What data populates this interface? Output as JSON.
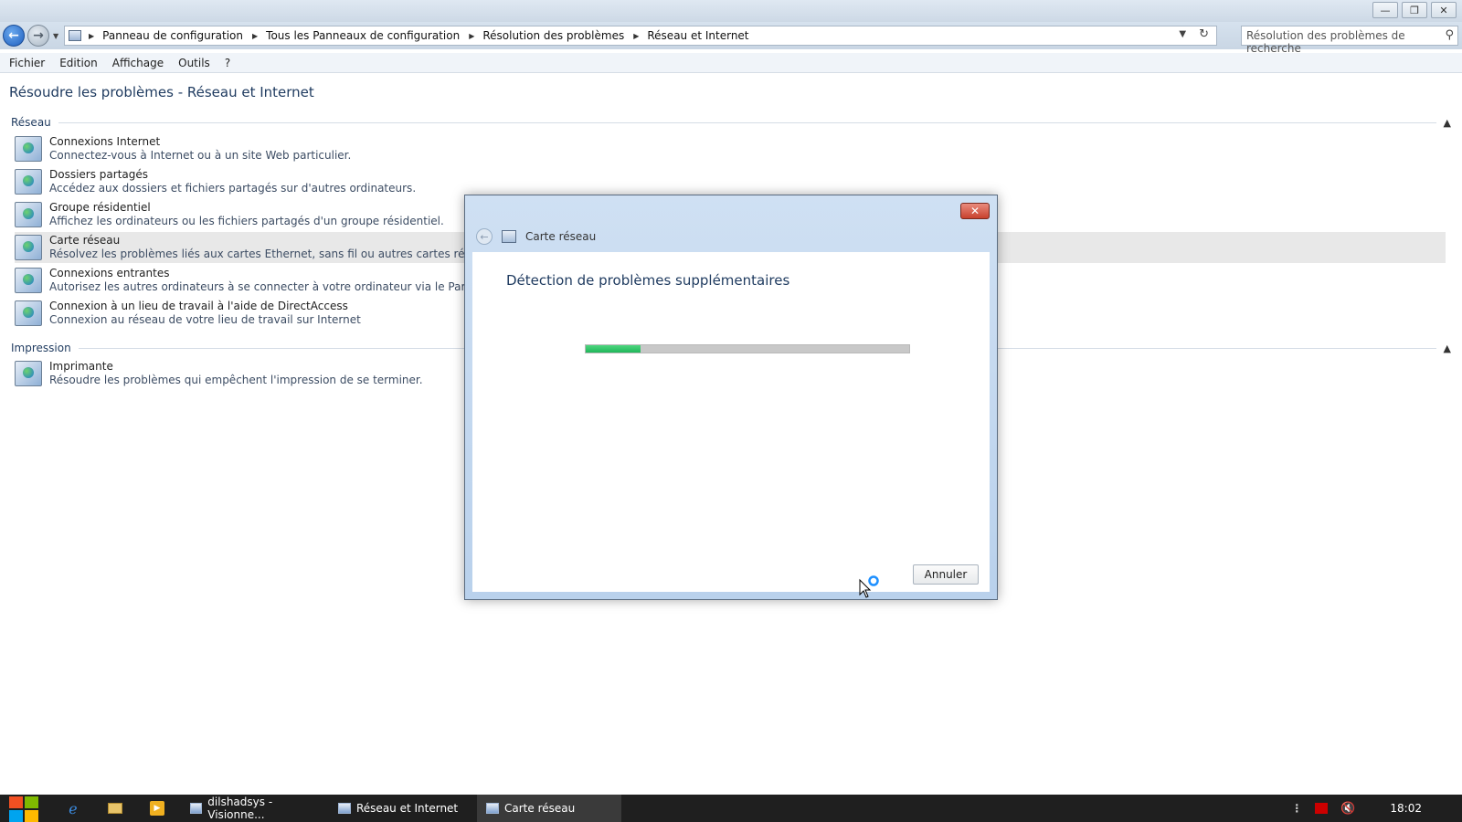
{
  "window": {
    "minimize_glyph": "—",
    "restore_glyph": "❐",
    "close_glyph": "✕"
  },
  "address": {
    "crumbs": [
      "Panneau de configuration",
      "Tous les Panneaux de configuration",
      "Résolution des problèmes",
      "Réseau et Internet"
    ],
    "search_placeholder": "Résolution des problèmes de recherche"
  },
  "menu": [
    "Fichier",
    "Edition",
    "Affichage",
    "Outils",
    "?"
  ],
  "page": {
    "title": "Résoudre les problèmes - Réseau et Internet",
    "groups": [
      {
        "label": "Réseau",
        "items": [
          {
            "title": "Connexions Internet",
            "desc": "Connectez-vous à Internet ou à un site Web particulier."
          },
          {
            "title": "Dossiers partagés",
            "desc": "Accédez aux dossiers et fichiers partagés sur d'autres ordinateurs."
          },
          {
            "title": "Groupe résidentiel",
            "desc": "Affichez les ordinateurs ou les fichiers partagés d'un groupe résidentiel."
          },
          {
            "title": "Carte réseau",
            "desc": "Résolvez les problèmes liés aux cartes Ethernet, sans fil ou autres cartes réseau."
          },
          {
            "title": "Connexions entrantes",
            "desc": "Autorisez les autres ordinateurs à se connecter à votre ordinateur via le Pare-feu Windo"
          },
          {
            "title": "Connexion à un lieu de travail à l'aide de DirectAccess",
            "desc": "Connexion au réseau de votre lieu de travail sur Internet"
          }
        ]
      },
      {
        "label": "Impression",
        "items": [
          {
            "title": "Imprimante",
            "desc": "Résoudre les problèmes qui empêchent l'impression de se terminer."
          }
        ]
      }
    ]
  },
  "dialog": {
    "title": "Carte réseau",
    "heading": "Détection de problèmes supplémentaires",
    "progress": 0.17,
    "cancel_label": "Annuler",
    "close_glyph": "✕"
  },
  "taskbar": {
    "tasks": [
      "dilshadsys - Visionne...",
      "Réseau et Internet",
      "Carte réseau"
    ],
    "clock": "18:02"
  },
  "colors": {
    "progress_fill": "#1fb65a",
    "accent": "#1e3a5f"
  }
}
